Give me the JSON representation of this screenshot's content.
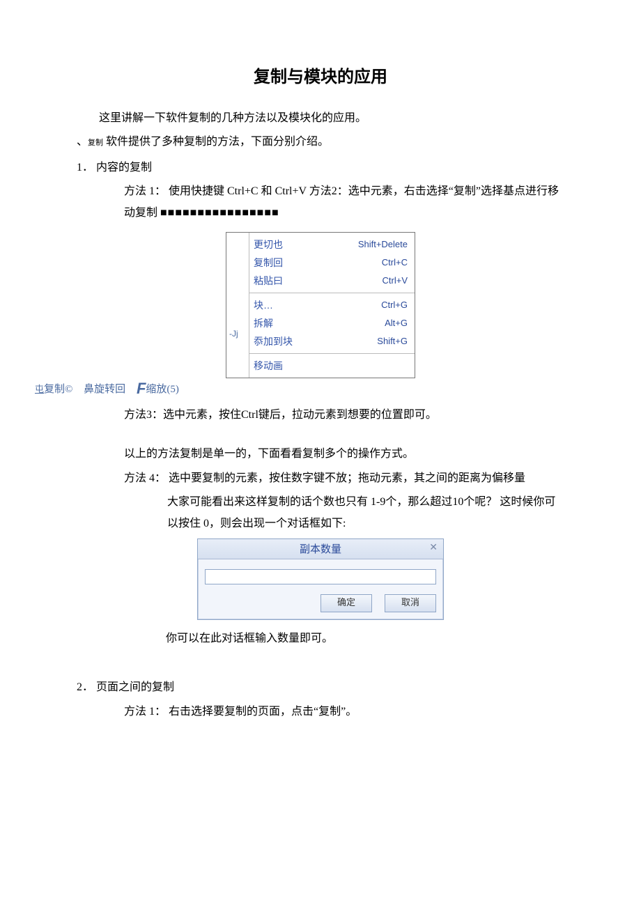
{
  "title": "复制与模块的应用",
  "intro": "这里讲解一下软件复制的几种方法以及模块化的应用。",
  "copy_label": "复制",
  "copy_intro": " 软件提供了多种复制的方法，下面分别介绍。",
  "sec1_num": "1．",
  "sec1_title": "内容的复制",
  "method1": "方法 1： 使用快捷键 Ctrl+C 和 Ctrl+V 方法2：选中元素，右击选择“复制”选择基点进行移动复制 ",
  "squares": "■■■■■■■■■■■■■■■■",
  "menu_gutter": "-Jj",
  "menu": [
    {
      "label": "更切也",
      "shortcut": "Shift+Delete"
    },
    {
      "label": "复制回",
      "shortcut": "Ctrl+C"
    },
    {
      "label": "粘贴曰",
      "shortcut": "Ctrl+V"
    }
  ],
  "menu2": [
    {
      "label": "块…",
      "shortcut": "Ctrl+G"
    },
    {
      "label": "拆解",
      "shortcut": "Alt+G"
    },
    {
      "label": "忝加到块",
      "shortcut": "Shift+G"
    }
  ],
  "menu3": [
    {
      "label": "移动画",
      "shortcut": ""
    }
  ],
  "toolbar": {
    "t1_pre": "屯",
    "t1": "复制©",
    "t2": "鼻旋转回",
    "t3_icon": "F",
    "t3": "缩放(5)"
  },
  "method3": "方法3：选中元素，按住Ctrl键后，拉动元素到想要的位置即可。",
  "single_note": "以上的方法复制是单一的，下面看看复制多个的操作方式。",
  "method4_l1": "方法 4： 选中要复制的元素，按住数字键不放；拖动元素，其之间的距离为偏移量",
  "method4_l2": "大家可能看出来这样复制的话个数也只有 1-9个，那么超过10个呢？ 这时候你可以按住 0，则会出现一个对话框如下:",
  "dialog": {
    "title": "副本数量",
    "close": "✕",
    "ok": "确定",
    "cancel": "取消"
  },
  "caption": "你可以在此对话框输入数量即可。",
  "sec2_num": "2．",
  "sec2_title": "页面之间的复制",
  "sec2_m1": "方法 1： 右击选择要复制的页面，点击“复制”。"
}
